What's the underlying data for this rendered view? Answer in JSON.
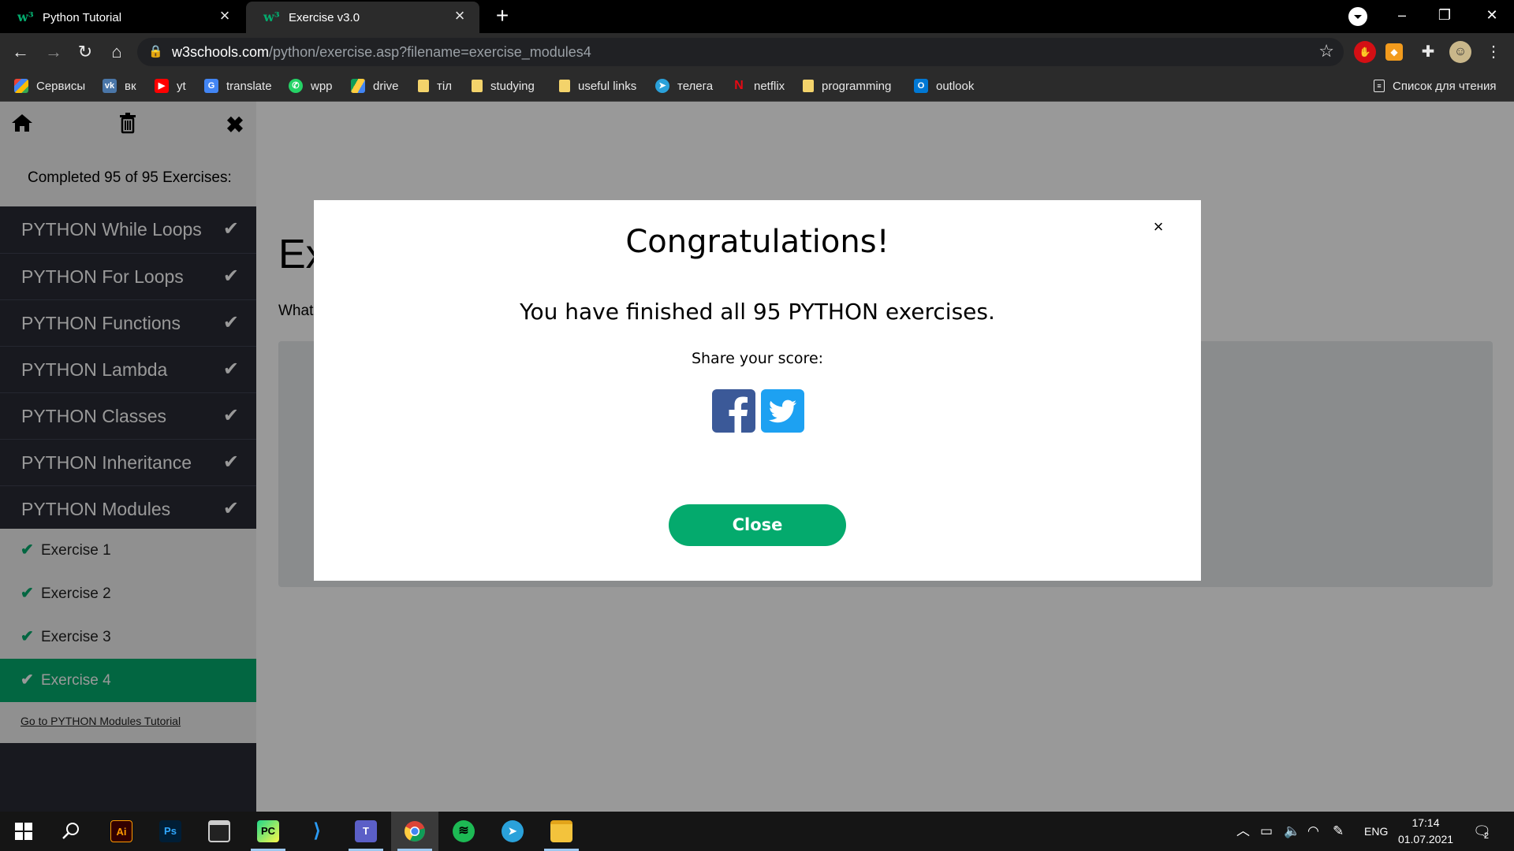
{
  "browser": {
    "tabs": [
      {
        "title": "Python Tutorial",
        "favicon": "w3schools-icon"
      },
      {
        "title": "Exercise v3.0",
        "favicon": "w3schools-icon"
      }
    ],
    "url_host": "w3schools.com",
    "url_path": "/python/exercise.asp?filename=exercise_modules4",
    "bookmarks": [
      {
        "label": "Сервисы",
        "icon": "apps-grid-icon"
      },
      {
        "label": "вк",
        "icon": "vk-icon"
      },
      {
        "label": "yt",
        "icon": "youtube-icon"
      },
      {
        "label": "translate",
        "icon": "google-translate-icon"
      },
      {
        "label": "wpp",
        "icon": "whatsapp-icon"
      },
      {
        "label": "drive",
        "icon": "google-drive-icon"
      },
      {
        "label": "тіл",
        "icon": "folder-icon"
      },
      {
        "label": "studying",
        "icon": "folder-icon"
      },
      {
        "label": "useful links",
        "icon": "folder-icon"
      },
      {
        "label": "телега",
        "icon": "telegram-icon"
      },
      {
        "label": "netflix",
        "icon": "netflix-icon"
      },
      {
        "label": "programming",
        "icon": "folder-icon"
      },
      {
        "label": "outlook",
        "icon": "outlook-icon"
      }
    ],
    "reading_list": "Список для чтения"
  },
  "sidebar": {
    "completed_text": "Completed 95 of 95 Exercises:",
    "modules": [
      "PYTHON While Loops",
      "PYTHON For Loops",
      "PYTHON Functions",
      "PYTHON Lambda",
      "PYTHON Classes",
      "PYTHON Inheritance",
      "PYTHON Modules"
    ],
    "exercises": [
      "Exercise 1",
      "Exercise 2",
      "Exercise 3",
      "Exercise 4"
    ],
    "active_exercise": "Exercise 4",
    "tutorial_link": "Go to PYTHON Modules Tutorial"
  },
  "main": {
    "title_partial": "Ex",
    "question_partial": "What"
  },
  "modal": {
    "title": "Congratulations!",
    "message": "You have finished all 95 PYTHON exercises.",
    "share_label": "Share your score:",
    "close_label": "Close",
    "close_x": "×"
  },
  "taskbar": {
    "language": "ENG",
    "time": "17:14",
    "date": "01.07.2021",
    "notification_count": "2"
  },
  "colors": {
    "accent": "#04aa6d",
    "sidebar_bg": "#282a35",
    "facebook": "#3b5998",
    "twitter": "#1da1f2"
  }
}
